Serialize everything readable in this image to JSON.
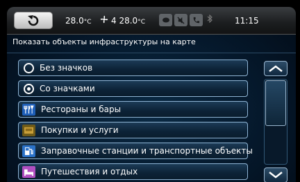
{
  "status": {
    "temp_left": "28.0",
    "temp_unit": "°C",
    "temp_fan_value": "4",
    "temp_right": "28.0",
    "clock": "11:15"
  },
  "title": "Показать объекты инфраструктуры на карте",
  "options": [
    {
      "label": "Без значков",
      "type": "radio",
      "selected": false
    },
    {
      "label": "Со значками",
      "type": "radio",
      "selected": true
    },
    {
      "label": "Рестораны и бары",
      "type": "category",
      "icon": "restaurant-icon"
    },
    {
      "label": "Покупки и услуги",
      "type": "category",
      "icon": "shopping-icon"
    },
    {
      "label": "Заправочные станции и транспортные объекты",
      "type": "category",
      "icon": "fuel-station-icon"
    },
    {
      "label": "Путешествия и отдых",
      "type": "category",
      "icon": "travel-icon"
    }
  ],
  "colors": {
    "accent": "#8fb4d4",
    "background": "#05182b"
  }
}
